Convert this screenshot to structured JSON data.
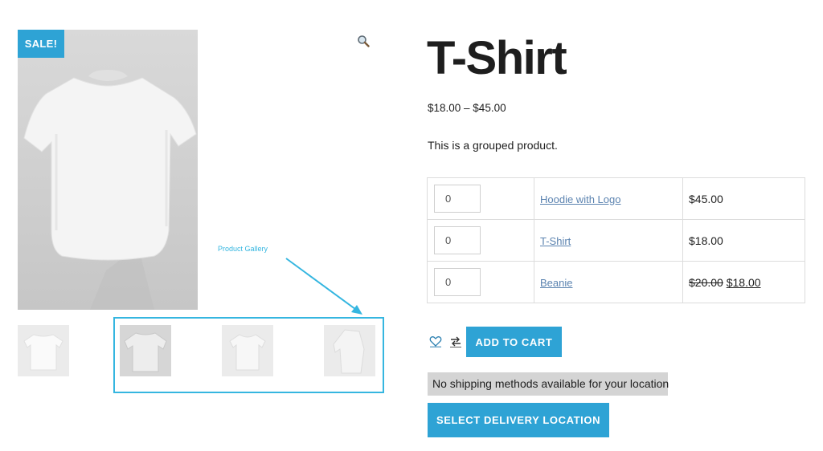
{
  "gallery": {
    "sale_badge": "SALE!",
    "annotation_label": "Product Gallery",
    "zoom_icon": "magnifier-icon",
    "thumbnail_count": 4,
    "highlight_color": "#35b6e0"
  },
  "product": {
    "title": "T-Shirt",
    "price_range": "$18.00 – $45.00",
    "short_description": "This is a grouped product.",
    "grouped_items": [
      {
        "qty": "0",
        "name": "Hoodie with Logo",
        "price": "$45.00",
        "regular_price": "",
        "sale_price": ""
      },
      {
        "qty": "0",
        "name": "T-Shirt",
        "price": "$18.00",
        "regular_price": "",
        "sale_price": ""
      },
      {
        "qty": "0",
        "name": "Beanie",
        "price": "",
        "regular_price": "$20.00",
        "sale_price": "$18.00"
      }
    ]
  },
  "actions": {
    "wishlist_icon": "heart-icon",
    "compare_icon": "compare-arrows-icon",
    "add_to_cart": "ADD TO CART",
    "shipping_notice": "No shipping methods available for your location",
    "select_delivery": "SELECT DELIVERY LOCATION"
  },
  "colors": {
    "accent": "#2ea3d5",
    "link": "#5b83b0",
    "notice_bg": "#d4d4d4"
  }
}
